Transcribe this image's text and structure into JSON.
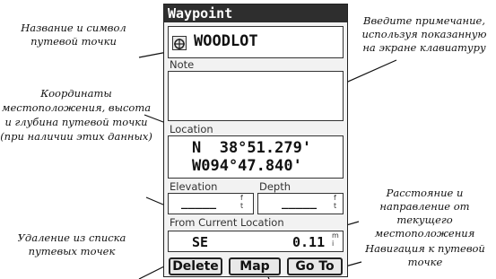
{
  "screen": {
    "title": "Waypoint",
    "waypoint_name": "WOODLOT",
    "note_label": "Note",
    "note_text": "",
    "location_label": "Location",
    "latitude": "N  38°51.279'",
    "longitude": "W094°47.840'",
    "elevation_label": "Elevation",
    "elevation_value": "_____",
    "elevation_unit": "f t",
    "depth_label": "Depth",
    "depth_value": "_____",
    "depth_unit": "f t",
    "from_location_label": "From Current Location",
    "bearing": "SE",
    "distance": "0.11",
    "distance_unit": "m i",
    "buttons": {
      "delete": "Delete",
      "map": "Map",
      "goto": "Go To"
    }
  },
  "callouts": {
    "name_symbol": "Название и символ путевой точки",
    "coordinates": "Координаты местоположения, высота и глубина путевой точки (при наличии этих данных)",
    "delete_desc": "Удаление из списка путевых точек",
    "note_desc": "Введите примечание, используя показанную на экране клавиатуру",
    "distance_desc": "Расстояние и направление от текущего местоположения",
    "navigate_desc": "Навигация к путевой точке"
  }
}
